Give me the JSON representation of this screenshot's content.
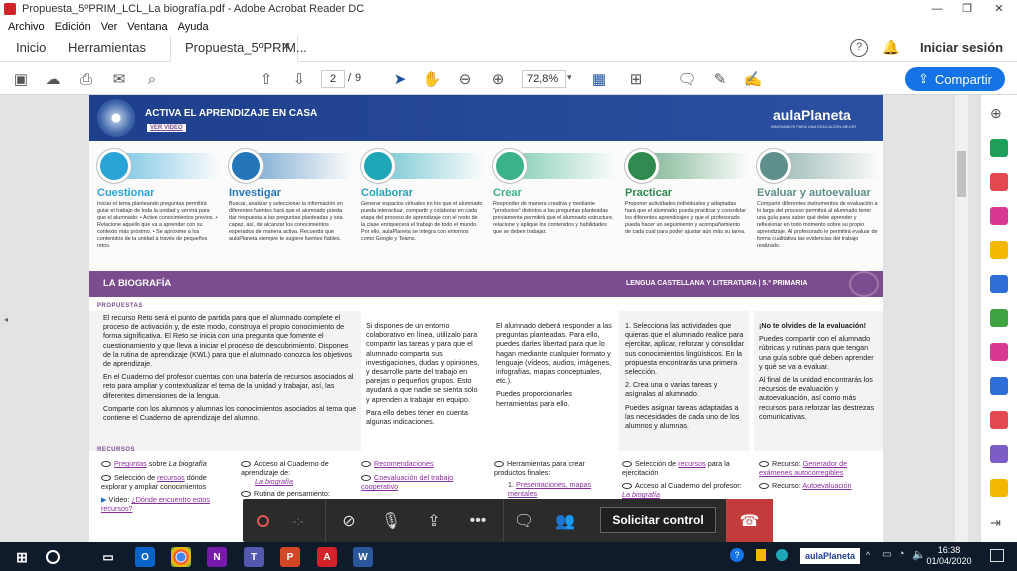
{
  "window": {
    "title": "Propuesta_5ºPRIM_LCL_La biografía.pdf - Adobe Acrobat Reader DC",
    "min": "—",
    "max": "❐",
    "close": "✕"
  },
  "menu": [
    "Archivo",
    "Edición",
    "Ver",
    "Ventana",
    "Ayuda"
  ],
  "tabs": {
    "home": "Inicio",
    "tools": "Herramientas",
    "doc": "Propuesta_5ºPRIM...",
    "doc_close": "✕",
    "signin": "Iniciar sesión"
  },
  "toolbar": {
    "page_current": "2",
    "page_sep": "/",
    "page_total": "9",
    "zoom": "72,8%",
    "share": "Compartir"
  },
  "doc": {
    "banner_title": "ACTIVA EL APRENDIZAJE EN CASA",
    "banner_video": "VER VÍDEO",
    "brand": "aulaPlaneta",
    "brand_tag": "INNOVAMOS PARA UNA EDUCACIÓN MEJOR",
    "phases": [
      {
        "title": "Cuestionar",
        "color": "#2aa3d6",
        "desc": "Iniciar el tema planteando preguntas permitirá guiar el trabajo de toda la unidad y servirá para que el alumnado: • Active conocimientos previos. • Relacione aquello que va a aprender con su contexto más próximo. • Se aproxime a los contenidos de la unidad a través de pequeños retos."
      },
      {
        "title": "Investigar",
        "color": "#2475b9",
        "desc": "Buscar, analizar y seleccionar la información en diferentes fuentes hará que el alumnado pueda dar respuesta a las preguntas planteadas y sea capaz, así, de alcanzar los conocimientos esperados de manera activa. Recuerda que aulaPlaneta siempre te sugiere fuentes fiables."
      },
      {
        "title": "Colaborar",
        "color": "#1fa7b8",
        "desc": "Generar espacios virtuales en los que el alumnado pueda interactuar, compartir y colaborar en cada etapa del proceso de aprendizaje con el resto de la clase enriquecerá el trabajo de todo el mundo. Por ello, aulaPlaneta se integra con entornos como Google y Teams."
      },
      {
        "title": "Crear",
        "color": "#3bb28a",
        "desc": "Responder de manera creativa y mediante \"productos\" distintos a las preguntas planteadas previamente permitirá que el alumnado estructure, relacione y aplique los contenidos y habilidades que se deben trabajar."
      },
      {
        "title": "Practicar",
        "color": "#2f8a4f",
        "desc": "Proponer actividades individuales y adaptadas hará que el alumnado pueda practicar y consolidar los diferentes aprendizajes y que el profesorado pueda hacer un seguimiento y acompañamiento de cada cual para poder ajustar aún más su tarea."
      },
      {
        "title": "Evaluar y autoevaluar",
        "color": "#5e8f8a",
        "desc": "Compartir diferentes instrumentos de evaluación a lo largo del proceso permitirá al alumnado tener una guía para saber qué debe aprender y reflexionar en todo momento sobre su propio aprendizaje. Al profesorado le permitirá evaluar de forma cualitativa las evidencias del trabajo realizado."
      }
    ],
    "bio_title": "LA BIOGRAFÍA",
    "bio_subject": "LENGUA CASTELLANA Y LITERATURA  |  5.º PRIMARIA",
    "propuestas_label": "PROPUESTAS",
    "col1": [
      "El recurso Reto será el punto de partida para que el alumnado complete el proceso de activación y, de este modo, construya el propio conocimiento de forma significativa. El Reto se inicia con una pregunta que fomente el cuestionamiento y que lleva a iniciar el proceso de descubrimiento. Dispones de la rutina de aprendizaje (KWL) para que el alumnado conozca los objetivos de aprendizaje.",
      "En el Cuaderno del profesor cuentas con una batería de recursos asociados al reto para ampliar y contextualizar el tema de la unidad y trabajar, así, las diferentes dimensiones de la lengua.",
      "Comparte con los alumnos y alumnas los conocimientos asociados al tema que contiene el Cuaderno de aprendizaje del alumno."
    ],
    "col2": [
      "Si dispones de un entorno colaborativo en línea, utilízalo para compartir las tareas y para que el alumnado comparta sus investigaciones, dudas y opiniones, y desarrolle parte del trabajo en parejas o pequeños grupos. Esto ayudará a que nadie se sienta solo y aprenden a trabajar en equipo.",
      "Para ello debes tener en cuenta algunas indicaciones."
    ],
    "col3": [
      "El alumnado deberá responder a las preguntas planteadas. Para ello, puedes darles libertad para que lo hagan mediante cualquier formato y lenguaje (vídeos, audios, imágenes, infografías, mapas conceptuales, etc.).",
      "Puedes proporcionarles herramientas para ello."
    ],
    "col4": [
      "1. Selecciona las actividades que quieras que el alumnado realice para ejercitar, aplicar, reforzar y consolidar sus conocimientos lingüísticos. En la propuesta encontrarás una primera selección.",
      "2. Crea una o varias tareas y asígnalas al alumnado.",
      "Puedes asignar tareas adaptadas a las necesidades de cada uno de los alumnos y alumnas."
    ],
    "col5": [
      "¡No te olvides de la evaluación!",
      "Puedes compartir con el alumnado rúbricas y rutinas para que tengan una guía sobre qué deben aprender y qué se va a evaluar.",
      "Al final de la unidad encontrarás los recursos de evaluación y autoevaluación, así como más recursos para reforzar las destrezas comunicativas."
    ],
    "recursos_label": "RECURSOS",
    "rec": {
      "c1a_link": "Preguntas",
      "c1a_text": " sobre ",
      "c1a_it": "La biografía",
      "c1b_pre": "Selección de ",
      "c1b_link": "recursos",
      "c1b_text": " dónde explorar y ampliar conocimientos",
      "c1c_pre": "Vídeo: ",
      "c1c_link": "¿Dónde encuentro estos recursos?",
      "c2a": "Acceso al Cuaderno de aprendizaje de:",
      "c2a_link": "La biografía",
      "c2b": "Rutina de pensamiento:",
      "c3a_link": "Recomendaciones",
      "c3b_link": "Coevaluación del trabajo cooperativo",
      "c4a": "Herramientas para crear productos finales:",
      "c4b_pre": "1.",
      "c4b_link": "Presentaciones, mapas mentales",
      "c5a_pre": "Selección de ",
      "c5a_link": "recursos",
      "c5a_text": " para la ejercitación",
      "c5b": "Acceso al Cuaderno del profesor: ",
      "c5b_link": "La biografía",
      "c6a_pre": "Recurso: ",
      "c6a_link": "Generador de exámenes autocorregibles",
      "c6b_pre": "Recurso: ",
      "c6b_link": "Autoevaluación"
    }
  },
  "call": {
    "control": "Solicitar control"
  },
  "clock": {
    "time": "16:38",
    "date": "01/04/2020"
  }
}
